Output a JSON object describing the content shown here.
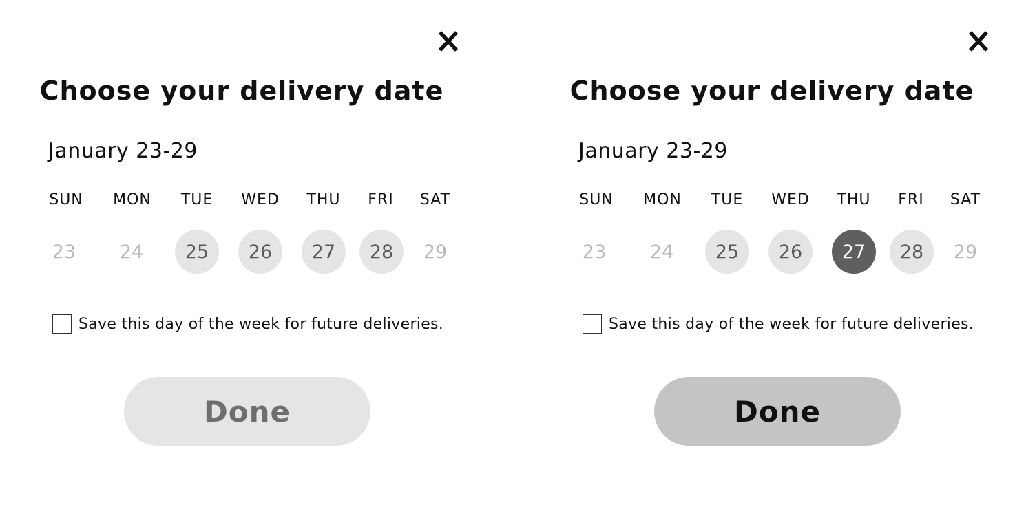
{
  "colors": {
    "available_day_bg": "#e5e5e5",
    "selected_day_bg": "#5f5f5f",
    "unavailable_day_text": "#b9b9b9",
    "done_disabled_bg": "#e5e5e5",
    "done_enabled_bg": "#c4c4c4"
  },
  "panels": [
    {
      "close_icon": "close-icon",
      "title": "Choose your delivery date",
      "week_range": "January 23-29",
      "days_of_week": [
        "SUN",
        "MON",
        "TUE",
        "WED",
        "THU",
        "FRI",
        "SAT"
      ],
      "dates": [
        {
          "label": "23",
          "state": "unavailable"
        },
        {
          "label": "24",
          "state": "unavailable"
        },
        {
          "label": "25",
          "state": "available"
        },
        {
          "label": "26",
          "state": "available"
        },
        {
          "label": "27",
          "state": "available"
        },
        {
          "label": "28",
          "state": "available"
        },
        {
          "label": "29",
          "state": "unavailable"
        }
      ],
      "save_checkbox_checked": false,
      "save_label": "Save this day of the week for future deliveries.",
      "done_label": "Done",
      "done_state": "disabled"
    },
    {
      "close_icon": "close-icon",
      "title": "Choose your delivery date",
      "week_range": "January 23-29",
      "days_of_week": [
        "SUN",
        "MON",
        "TUE",
        "WED",
        "THU",
        "FRI",
        "SAT"
      ],
      "dates": [
        {
          "label": "23",
          "state": "unavailable"
        },
        {
          "label": "24",
          "state": "unavailable"
        },
        {
          "label": "25",
          "state": "available"
        },
        {
          "label": "26",
          "state": "available"
        },
        {
          "label": "27",
          "state": "selected"
        },
        {
          "label": "28",
          "state": "available"
        },
        {
          "label": "29",
          "state": "unavailable"
        }
      ],
      "save_checkbox_checked": false,
      "save_label": "Save this day of the week for future deliveries.",
      "done_label": "Done",
      "done_state": "enabled"
    }
  ]
}
